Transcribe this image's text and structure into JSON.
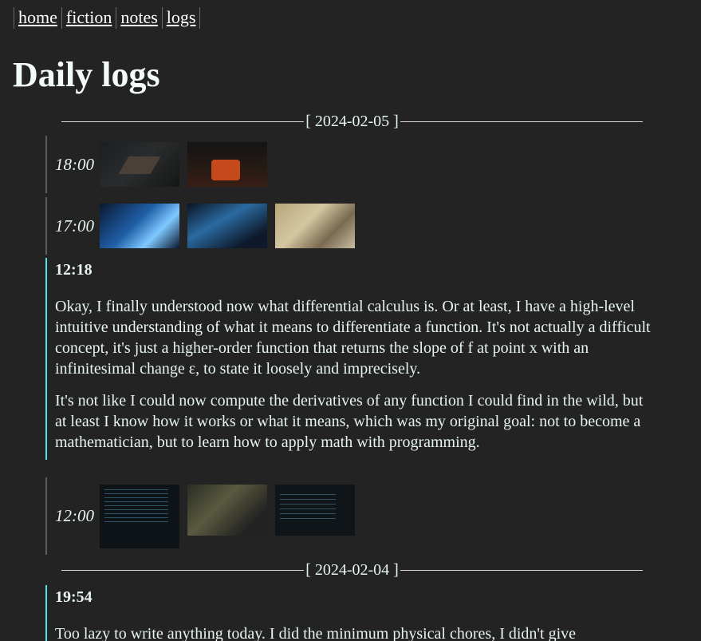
{
  "nav": {
    "items": [
      "home",
      "fiction",
      "notes",
      "logs"
    ]
  },
  "page": {
    "title": "Daily logs"
  },
  "days": [
    {
      "date_label": "[ 2024-02-05 ]",
      "entries": [
        {
          "kind": "screenshots",
          "time": "18:00"
        },
        {
          "kind": "screenshots",
          "time": "17:00"
        },
        {
          "kind": "text",
          "time": "12:18",
          "paragraphs": [
            "Okay, I finally understood now what differential calculus is. Or at least, I have a high-level intuitive understanding of what it means to differentiate a function. It's not actually a difficult concept, it's just a higher-order function that returns the slope of f at point x with an infinitesimal change ε, to state it loosely and imprecisely.",
            "It's not like I could now compute the derivatives of any function I could find in the wild, but at least I know how it works or what it means, which was my original goal: not to become a mathematician, but to learn how to apply math with programming."
          ]
        },
        {
          "kind": "screenshots",
          "time": "12:00"
        }
      ]
    },
    {
      "date_label": "[ 2024-02-04 ]",
      "entries": [
        {
          "kind": "text",
          "time": "19:54",
          "paragraphs": [
            "Too lazy to write anything today. I did the minimum physical chores, I didn't give"
          ]
        }
      ]
    }
  ]
}
